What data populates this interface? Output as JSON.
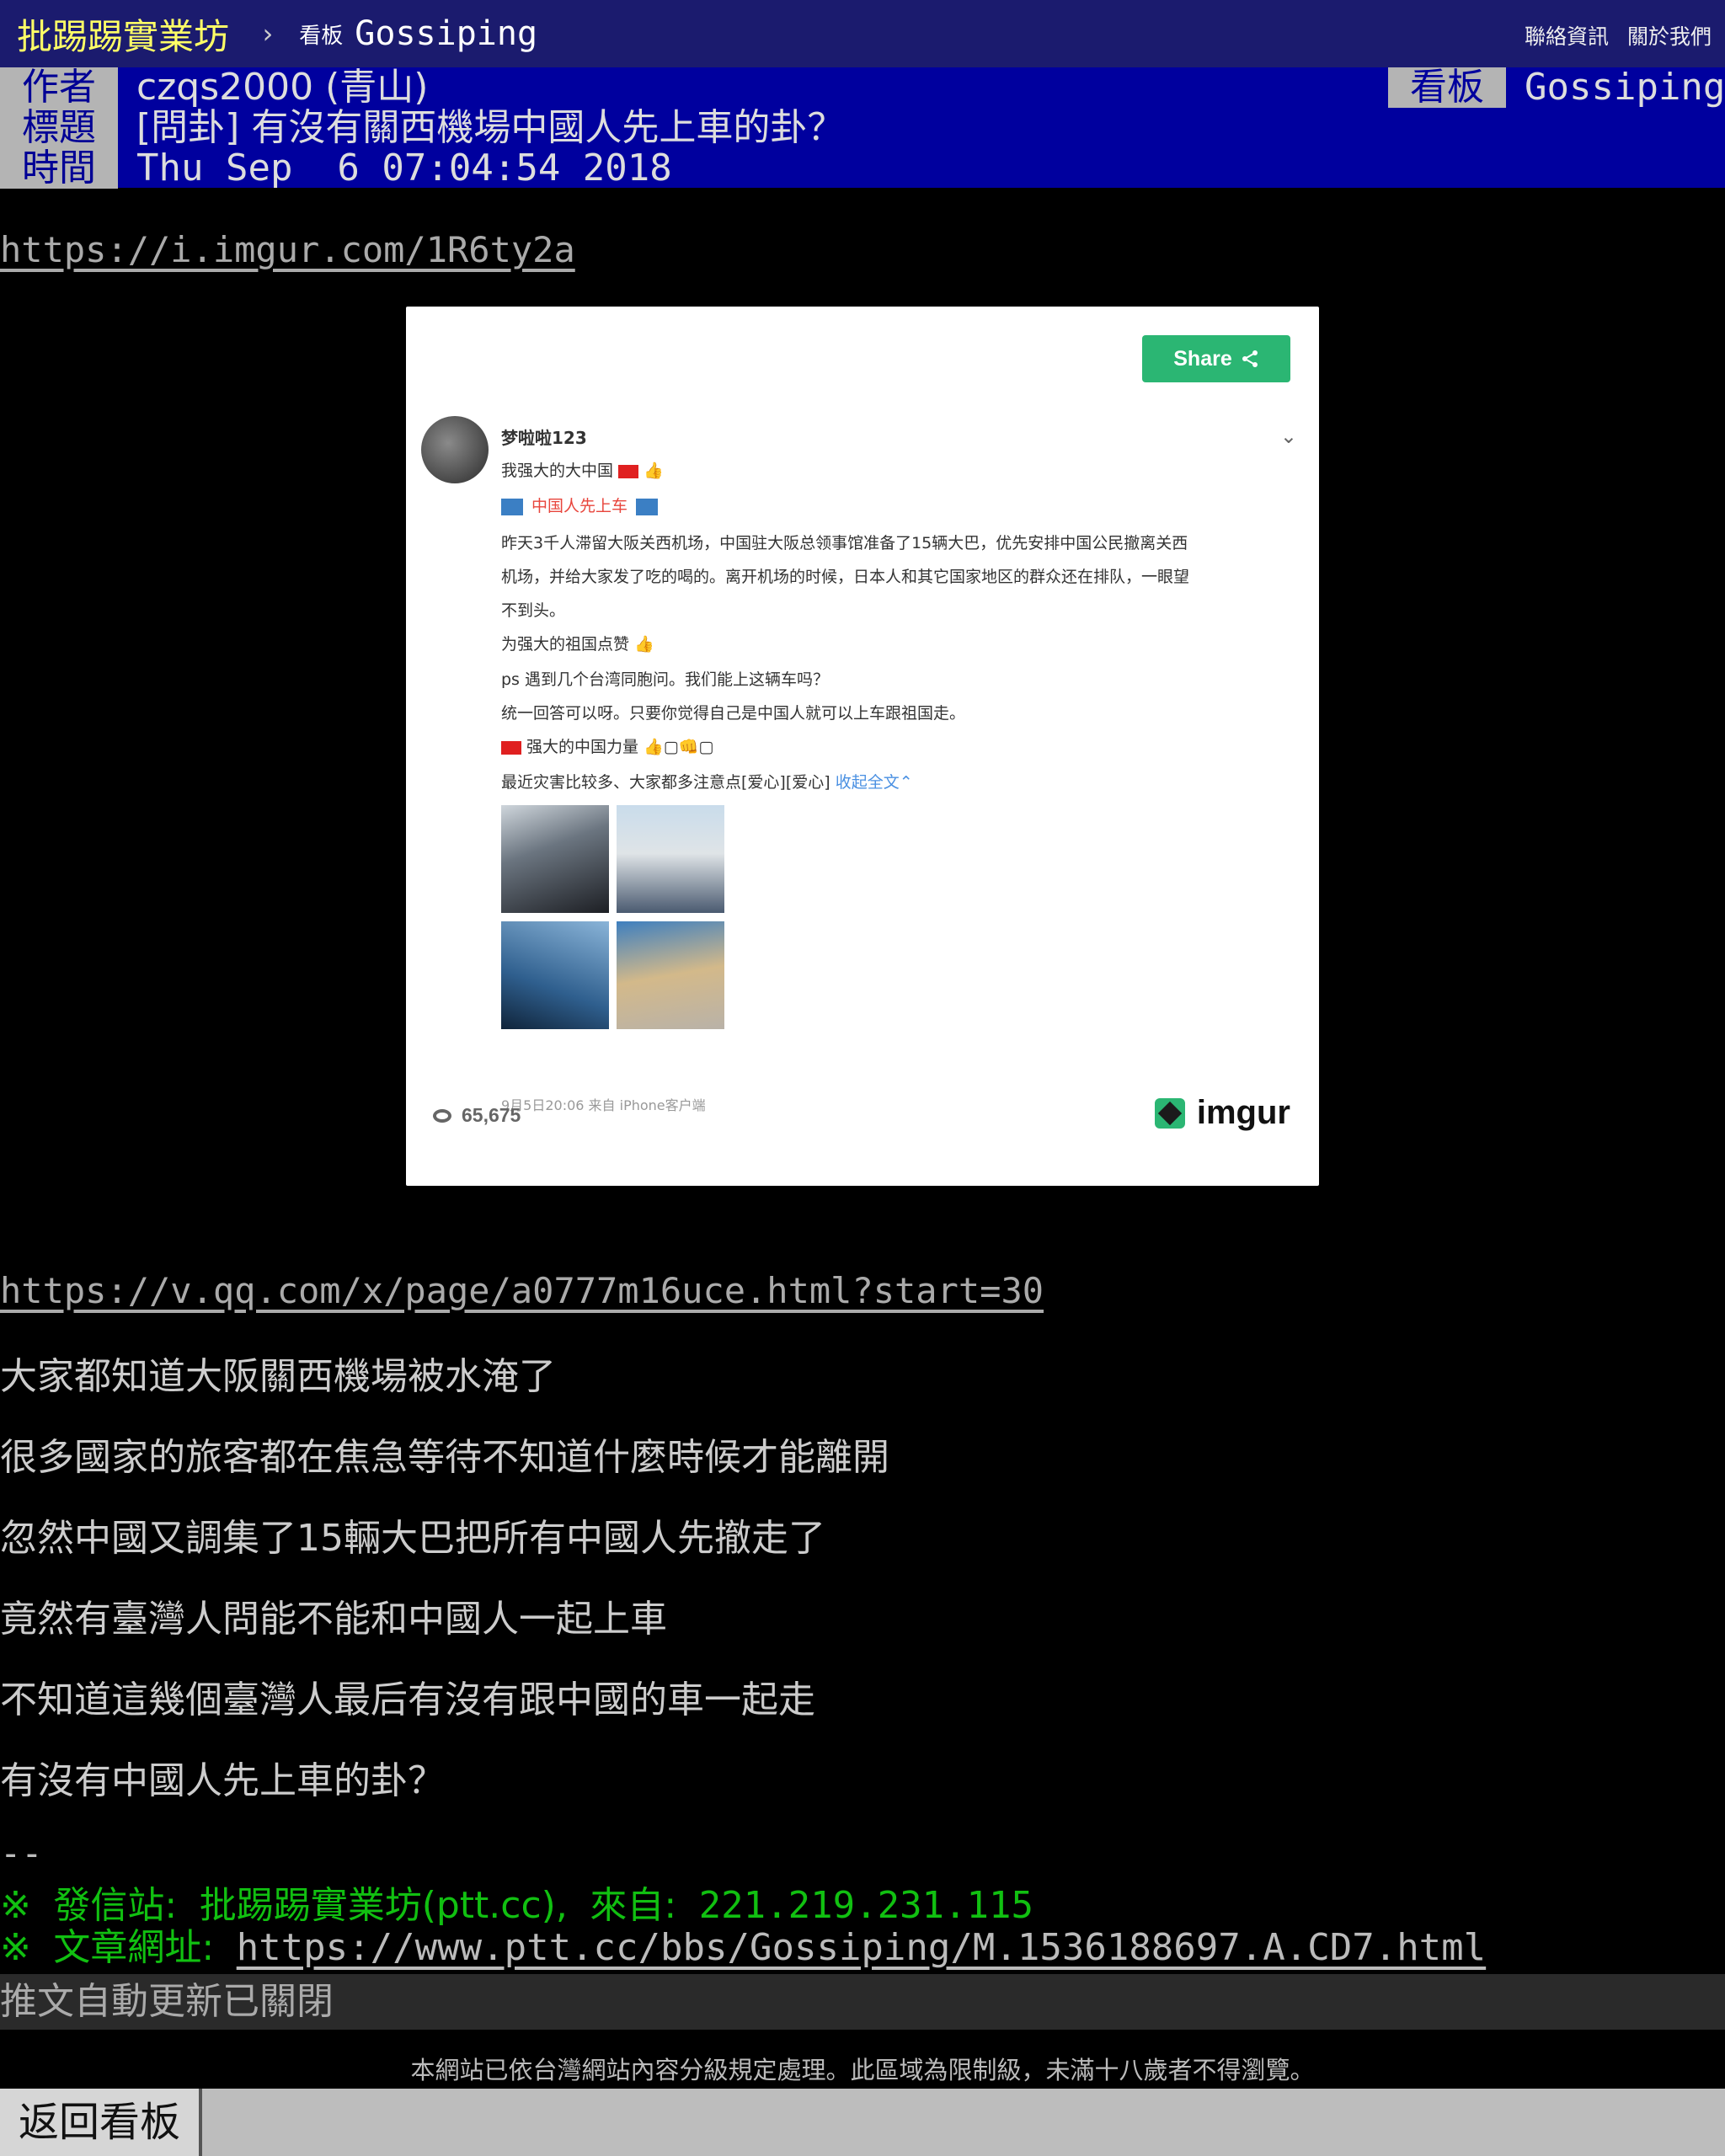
{
  "topbar": {
    "site_name": "批踢踢實業坊",
    "separator": "›",
    "board_label": "看板",
    "board_name": "Gossiping",
    "links": [
      "聯絡資訊",
      "關於我們"
    ]
  },
  "meta": {
    "author_label": "作者",
    "author": "czqs2000 (青山)",
    "title_label": "標題",
    "title": "[問卦] 有沒有關西機場中國人先上車的卦？",
    "time_label": "時間",
    "time": "Thu Sep  6 07:04:54 2018",
    "board_label": "看板",
    "board": "Gossiping"
  },
  "content": {
    "imgur_link": "https://i.imgur.com/1R6ty2a",
    "video_link": "https://v.qq.com/x/page/a0777m16uce.html?start=30",
    "lines": [
      "大家都知道大阪關西機場被水淹了",
      "很多國家的旅客都在焦急等待不知道什麼時候才能離開",
      "忽然中國又調集了15輛大巴把所有中國人先撤走了",
      "竟然有臺灣人問能不能和中國人一起上車",
      "不知道這幾個臺灣人最后有沒有跟中國的車一起走",
      "有沒有中國人先上車的卦？"
    ],
    "sig_dash": "--"
  },
  "embed": {
    "share_label": "Share",
    "views": "65,675",
    "logo_text": "imgur",
    "weibo": {
      "user": "梦啦啦123",
      "line1": "我强大的大中国",
      "tag": "中国人先上车",
      "para1": "昨天3千人滞留大阪关西机场，中国驻大阪总领事馆准备了15辆大巴，优先安排中国公民撤离关西",
      "para2": "机场，并给大家发了吃的喝的。离开机场的时候，日本人和其它国家地区的群众还在排队，一眼望",
      "para3": "不到头。",
      "line_praise": "为强大的祖国点赞",
      "line_ps": "ps 遇到几个台湾同胞问。我们能上这辆车吗？",
      "line_answer": "统一回答可以呀。只要你觉得自己是中国人就可以上车跟祖国走。",
      "line_power": "强大的中国力量",
      "line_last": "最近灾害比较多、大家都多注意点[爱心][爱心]",
      "collapse": "收起全文⌃",
      "meta": "9月5日20:06 来自 iPhone客户端"
    }
  },
  "signature": {
    "mark": "※",
    "station_label": "發信站:",
    "station": "批踢踢實業坊(ptt.cc),",
    "from_label": "來自:",
    "ip": "221.219.231.115",
    "url_label": "文章網址:",
    "url": "https://www.ptt.cc/bbs/Gossiping/M.1536188697.A.CD7.html"
  },
  "footer": {
    "push_status": "推文自動更新已關閉",
    "notice": "本網站已依台灣網站內容分級規定處理。此區域為限制級，未滿十八歲者不得瀏覽。",
    "back_button": "返回看板"
  },
  "colors": {
    "topbar_bg": "#1b1b6e",
    "meta_bg": "#00009e",
    "site_name": "#ffff66",
    "signature_green": "#11c011",
    "share_green": "#2bb673"
  }
}
